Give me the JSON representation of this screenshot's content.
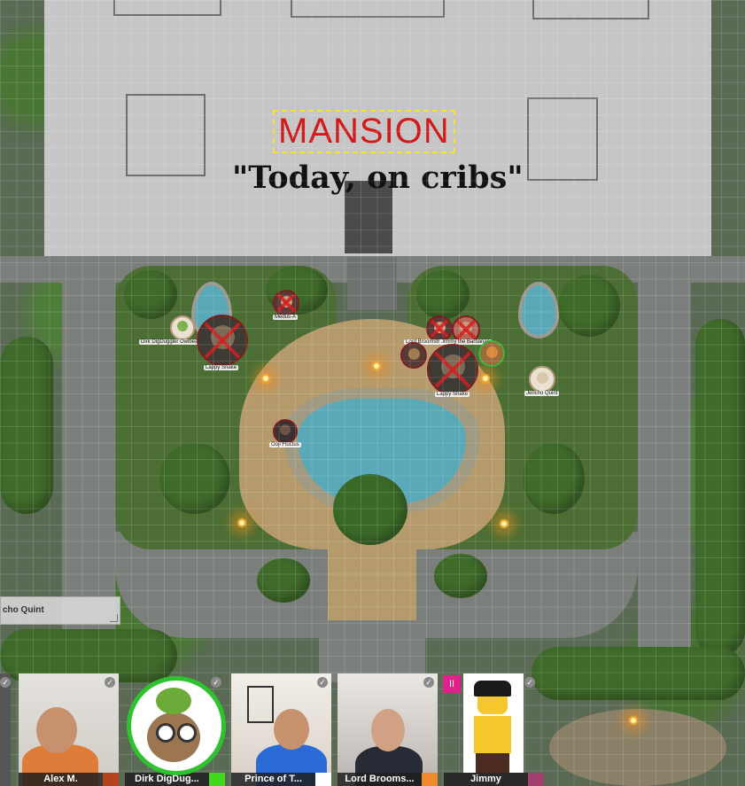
{
  "map": {
    "title": "MANSION",
    "subtitle": "\"Today, on cribs\""
  },
  "tokens": [
    {
      "label": "Dirk DigDuggler Owlbear Smuggler"
    },
    {
      "label": "Medus-A"
    },
    {
      "label": "Lappy Snake"
    },
    {
      "label": "Lord Broomsby"
    },
    {
      "label": "Jimmy the Barbarian"
    },
    {
      "label": "Lappy Snake"
    },
    {
      "label": "Jericho Quint"
    },
    {
      "label": "Ooji Fluctus"
    }
  ],
  "chat": {
    "text": "cho Quint"
  },
  "participants": [
    {
      "name": "Alex M.",
      "color": "#b5441e"
    },
    {
      "name": "Dirk DigDug...",
      "color": "#42d81e"
    },
    {
      "name": "Prince of T...",
      "color": "#ffffff"
    },
    {
      "name": "Lord Brooms...",
      "color": "#f08a30"
    },
    {
      "name": "Jimmy",
      "color": "#a2406e"
    }
  ],
  "badges": {
    "pause": "II"
  }
}
